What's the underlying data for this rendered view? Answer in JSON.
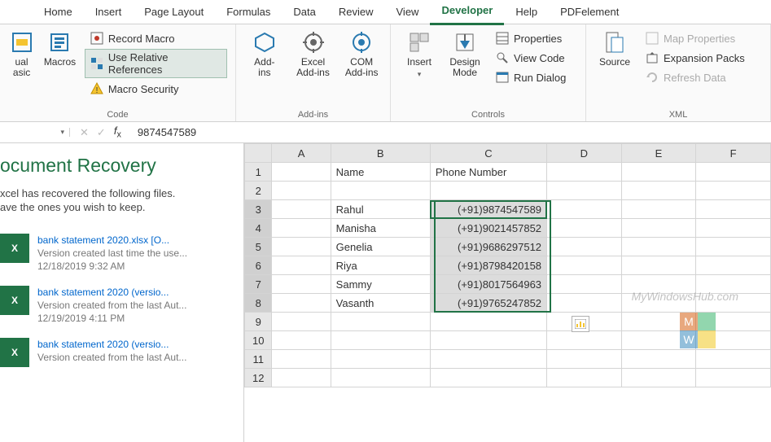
{
  "tabs": [
    "Home",
    "Insert",
    "Page Layout",
    "Formulas",
    "Data",
    "Review",
    "View",
    "Developer",
    "Help",
    "PDFelement"
  ],
  "active_tab": "Developer",
  "ribbon": {
    "code": {
      "visual_basic": "ual\nasic",
      "macros": "Macros",
      "record_macro": "Record Macro",
      "use_relative": "Use Relative References",
      "macro_security": "Macro Security",
      "label": "Code"
    },
    "addins": {
      "addins": "Add-\nins",
      "excel_addins": "Excel\nAdd-ins",
      "com_addins": "COM\nAdd-ins",
      "label": "Add-ins"
    },
    "controls": {
      "insert": "Insert",
      "design_mode": "Design\nMode",
      "properties": "Properties",
      "view_code": "View Code",
      "run_dialog": "Run Dialog",
      "label": "Controls"
    },
    "xml": {
      "source": "Source",
      "map_properties": "Map Properties",
      "expansion_packs": "Expansion Packs",
      "refresh_data": "Refresh Data",
      "label": "XML"
    }
  },
  "namebox": "",
  "formula": "9874547589",
  "recovery": {
    "title": "ocument Recovery",
    "msg_line1": "xcel has recovered the following files.",
    "msg_line2": "ave the ones you wish to keep.",
    "items": [
      {
        "name": "bank statement 2020.xlsx  [O...",
        "sub": "Version created last time the use...",
        "time": "12/18/2019 9:32 AM"
      },
      {
        "name": "bank statement 2020 (versio...",
        "sub": "Version created from the last Aut...",
        "time": "12/19/2019 4:11 PM"
      },
      {
        "name": "bank statement 2020 (versio...",
        "sub": "Version created from the last Aut...",
        "time": ""
      }
    ]
  },
  "columns": [
    "A",
    "B",
    "C",
    "D",
    "E",
    "F"
  ],
  "rows": [
    "1",
    "2",
    "3",
    "4",
    "5",
    "6",
    "7",
    "8",
    "9",
    "10",
    "11",
    "12"
  ],
  "headers": {
    "B1": "Name",
    "C1": "Phone Number"
  },
  "data": [
    {
      "name": "Rahul",
      "phone": "(+91)9874547589"
    },
    {
      "name": "Manisha",
      "phone": "(+91)9021457852"
    },
    {
      "name": "Genelia",
      "phone": "(+91)9686297512"
    },
    {
      "name": "Riya",
      "phone": "(+91)8798420158"
    },
    {
      "name": "Sammy",
      "phone": "(+91)8017564963"
    },
    {
      "name": "Vasanth",
      "phone": "(+91)9765247852"
    }
  ],
  "watermark": "MyWindowsHub.com"
}
